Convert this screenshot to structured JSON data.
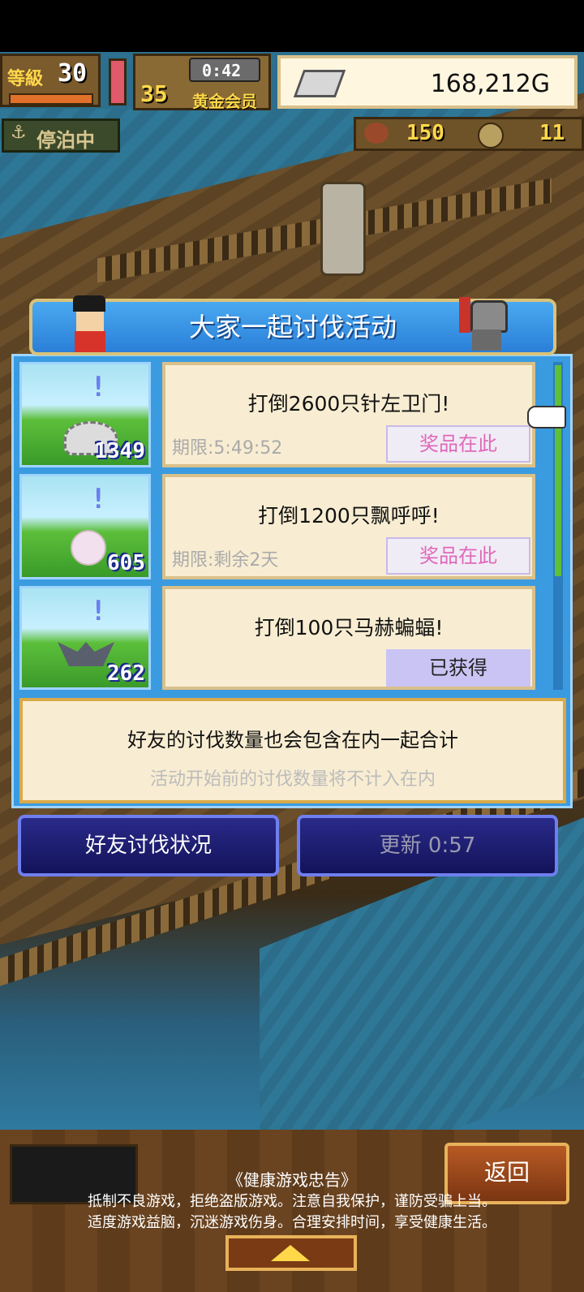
{
  "hud": {
    "level_label": "等級",
    "level_value": "30",
    "rank_value": "35",
    "timer": "0:42",
    "membership": "黄金会员",
    "gold": "168,212G",
    "status": "停泊中",
    "meat_count": "150",
    "coin_count": "11"
  },
  "dialog": {
    "title": "大家一起讨伐活动",
    "quests": [
      {
        "title": "打倒2600只针左卫门!",
        "deadline": "期限:5:49:52",
        "count": "1349",
        "button": "奖品在此",
        "state": "prize"
      },
      {
        "title": "打倒1200只飘呼呼!",
        "deadline": "期限:剩余2天",
        "count": "605",
        "button": "奖品在此",
        "state": "prize"
      },
      {
        "title": "打倒100只马赫蝙蝠!",
        "deadline": "",
        "count": "262",
        "button": "已获得",
        "state": "obtained"
      }
    ],
    "info_main": "好友的讨伐数量也会包含在内一起合计",
    "info_sub": "活动开始前的讨伐数量将不计入在内",
    "friend_button": "好友讨伐状况",
    "refresh_button": "更新 0:57"
  },
  "footer": {
    "back_button": "返回",
    "notice_title": "《健康游戏忠告》",
    "notice_line1": "抵制不良游戏，拒绝盗版游戏。注意自我保护，谨防受骗上当。",
    "notice_line2": "适度游戏益脑，沉迷游戏伤身。合理安排时间，享受健康生活。"
  },
  "colors": {
    "accent_blue": "#3a9be0",
    "prize_pink": "#e068b8",
    "gold_text": "#ffd84a"
  }
}
